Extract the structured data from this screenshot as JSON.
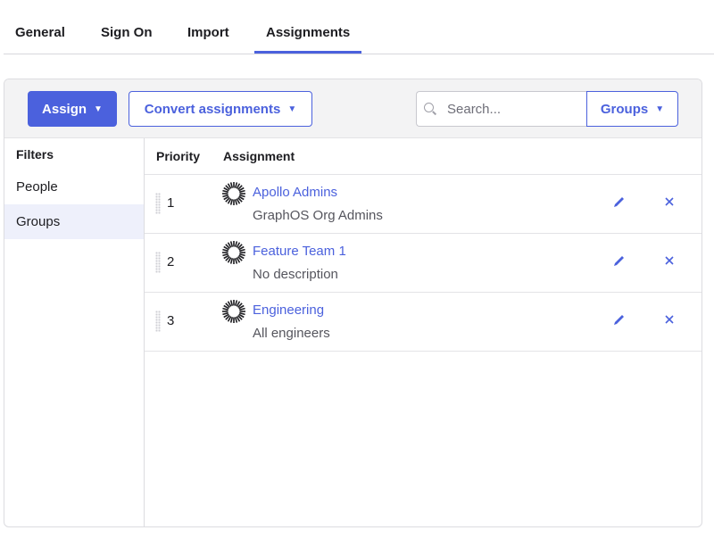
{
  "tabs": [
    {
      "label": "General",
      "active": false
    },
    {
      "label": "Sign On",
      "active": false
    },
    {
      "label": "Import",
      "active": false
    },
    {
      "label": "Assignments",
      "active": true
    }
  ],
  "toolbar": {
    "assign_label": "Assign",
    "convert_label": "Convert assignments",
    "search_placeholder": "Search...",
    "search_value": "",
    "filter_dropdown_label": "Groups",
    "caret": "▼"
  },
  "sidebar": {
    "heading": "Filters",
    "items": [
      {
        "label": "People",
        "selected": false
      },
      {
        "label": "Groups",
        "selected": true
      }
    ]
  },
  "table": {
    "columns": [
      "Priority",
      "Assignment"
    ],
    "rows": [
      {
        "priority": "1",
        "name": "Apollo Admins",
        "description": "GraphOS Org Admins",
        "icon": "group-icon"
      },
      {
        "priority": "2",
        "name": "Feature Team 1",
        "description": "No description",
        "icon": "group-icon"
      },
      {
        "priority": "3",
        "name": "Engineering",
        "description": "All engineers",
        "icon": "group-icon"
      }
    ]
  },
  "colors": {
    "accent": "#4b61dd",
    "selected_bg": "#eef0fb",
    "toolbar_bg": "#f3f3f4"
  }
}
